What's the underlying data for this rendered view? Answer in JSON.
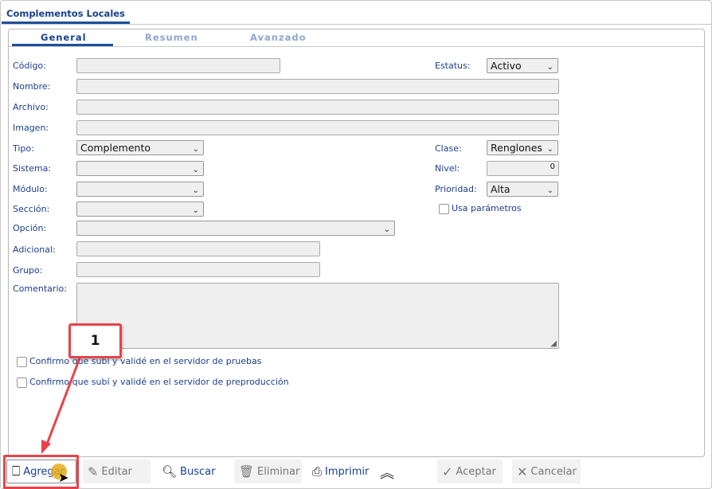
{
  "window": {
    "tab": "Complementos Locales"
  },
  "tabs": [
    {
      "label": "General",
      "active": true
    },
    {
      "label": "Resumen"
    },
    {
      "label": "Avanzado"
    }
  ],
  "form": {
    "codigo": {
      "label": "Código:",
      "value": ""
    },
    "estatus": {
      "label": "Estatus:",
      "value": "Activo"
    },
    "nombre": {
      "label": "Nombre:",
      "value": ""
    },
    "archivo": {
      "label": "Archivo:",
      "value": ""
    },
    "imagen": {
      "label": "Imagen:",
      "value": ""
    },
    "tipo": {
      "label": "Tipo:",
      "value": "Complemento"
    },
    "clase": {
      "label": "Clase:",
      "value": "Renglones"
    },
    "sistema": {
      "label": "Sistema:",
      "value": ""
    },
    "nivel": {
      "label": "Nivel:",
      "value": "0"
    },
    "modulo": {
      "label": "Módulo:",
      "value": ""
    },
    "prioridad": {
      "label": "Prioridad:",
      "value": "Alta"
    },
    "seccion": {
      "label": "Sección:",
      "value": ""
    },
    "usa_parametros": {
      "label": "Usa parámetros",
      "checked": false
    },
    "opcion": {
      "label": "Opción:",
      "value": ""
    },
    "adicional": {
      "label": "Adicional:",
      "value": ""
    },
    "grupo": {
      "label": "Grupo:",
      "value": ""
    },
    "comentario": {
      "label": "Comentario:",
      "value": ""
    },
    "confirm_pruebas": {
      "label": "Confirmo que subí y validé en el servidor de pruebas",
      "checked": false
    },
    "confirm_preprod": {
      "label": "Confirmo que subí y validé en el servidor de preproducción",
      "checked": false
    }
  },
  "toolbar": {
    "agregar": "Agregar",
    "editar": "Editar",
    "buscar": "Buscar",
    "eliminar": "Eliminar",
    "imprimir": "Imprimir",
    "aceptar": "Aceptar",
    "cancelar": "Cancelar"
  },
  "annotation": {
    "step": "1",
    "color": "#e8424a"
  }
}
